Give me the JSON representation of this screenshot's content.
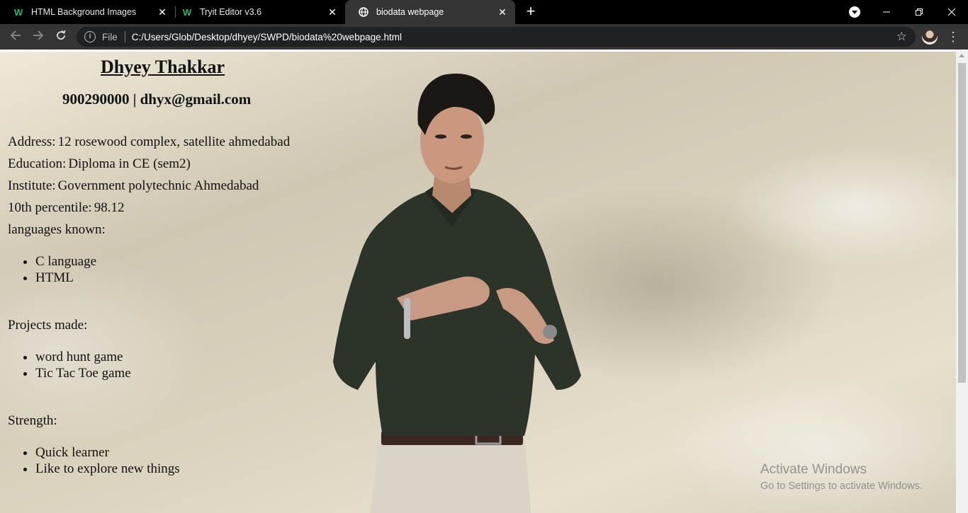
{
  "browser": {
    "tabs": [
      {
        "label": "HTML Background Images",
        "icon": "w3schools-icon",
        "active": false
      },
      {
        "label": "Tryit Editor v3.6",
        "icon": "w3schools-icon",
        "active": false
      },
      {
        "label": "biodata webpage",
        "icon": "globe-icon",
        "active": true
      }
    ],
    "address": {
      "scheme_label": "File",
      "url": "C:/Users/Glob/Desktop/dhyey/SWPD/biodata%20webpage.html"
    }
  },
  "page": {
    "name": "Dhyey Thakkar",
    "contact": "900290000 | dhyx@gmail.com",
    "details": [
      {
        "label": "Address:",
        "value": "12 rosewood complex, satellite ahmedabad"
      },
      {
        "label": "Education:",
        "value": "Diploma in CE (sem2)"
      },
      {
        "label": "Institute:",
        "value": "Government polytechnic Ahmedabad"
      },
      {
        "label": "10th percentile:",
        "value": "98.12"
      }
    ],
    "languages_heading": "languages known:",
    "languages": [
      "C language",
      "HTML"
    ],
    "projects_heading": "Projects made:",
    "projects": [
      "word hunt game",
      "Tic Tac Toe game"
    ],
    "strength_heading": "Strength:",
    "strengths": [
      "Quick learner",
      "Like to explore new things"
    ]
  },
  "watermark": {
    "title": "Activate Windows",
    "subtitle": "Go to Settings to activate Windows."
  }
}
